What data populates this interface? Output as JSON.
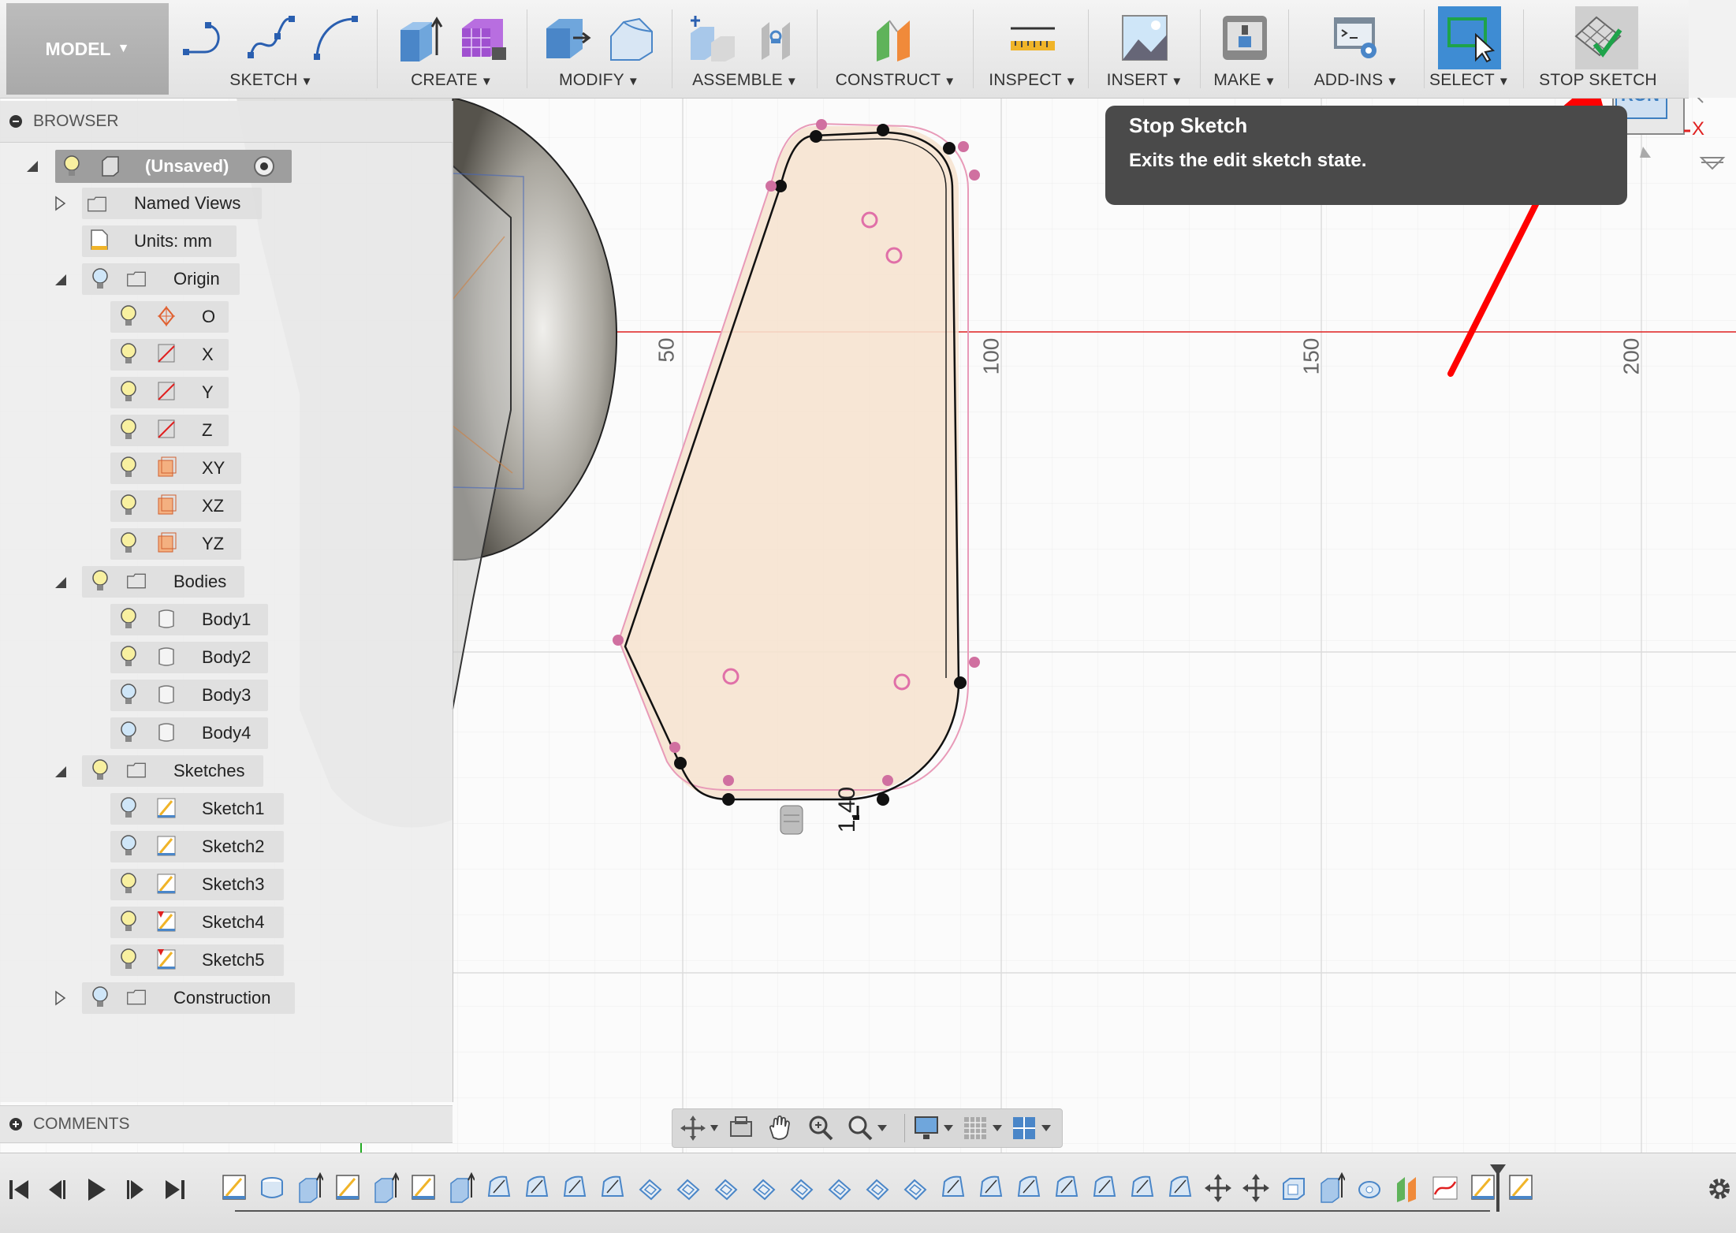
{
  "toolbar": {
    "workspace": "MODEL",
    "groups": [
      {
        "label": "SKETCH",
        "icons": [
          "line-icon",
          "spline-icon",
          "arc-icon"
        ]
      },
      {
        "label": "CREATE",
        "icons": [
          "extrude-icon",
          "pattern-icon"
        ]
      },
      {
        "label": "MODIFY",
        "icons": [
          "press-pull-icon",
          "fillet-icon"
        ]
      },
      {
        "label": "ASSEMBLE",
        "icons": [
          "new-component-icon",
          "joint-icon"
        ]
      },
      {
        "label": "CONSTRUCT",
        "icons": [
          "plane-icon"
        ]
      },
      {
        "label": "INSPECT",
        "icons": [
          "measure-icon"
        ]
      },
      {
        "label": "INSERT",
        "icons": [
          "insert-image-icon"
        ]
      },
      {
        "label": "MAKE",
        "icons": [
          "3d-print-icon"
        ]
      },
      {
        "label": "ADD-INS",
        "icons": [
          "scripts-icon"
        ]
      },
      {
        "label": "SELECT",
        "icons": [
          "select-icon"
        ]
      },
      {
        "label": "STOP SKETCH",
        "icons": [
          "stop-sketch-icon"
        ]
      }
    ]
  },
  "browser": {
    "title": "BROWSER",
    "root": "(Unsaved)",
    "items": {
      "named_views": "Named Views",
      "units": "Units: mm",
      "origin": "Origin",
      "origin_o": "O",
      "origin_x": "X",
      "origin_y": "Y",
      "origin_z": "Z",
      "origin_xy": "XY",
      "origin_xz": "XZ",
      "origin_yz": "YZ",
      "bodies": "Bodies",
      "body1": "Body1",
      "body2": "Body2",
      "body3": "Body3",
      "body4": "Body4",
      "sketches": "Sketches",
      "sketch1": "Sketch1",
      "sketch2": "Sketch2",
      "sketch3": "Sketch3",
      "sketch4": "Sketch4",
      "sketch5": "Sketch5",
      "construction": "Construction"
    }
  },
  "comments": {
    "title": "COMMENTS"
  },
  "tooltip": {
    "title": "Stop Sketch",
    "description": "Exits the edit sketch state."
  },
  "viewport": {
    "ruler_labels": [
      "50",
      "100",
      "150",
      "200"
    ],
    "dimension_label": "1.40",
    "viewcube_axis": "X",
    "viewcube_face": "RON"
  },
  "colors": {
    "select_accent": "#3e8cd3",
    "profile_fill": "#f6e3d0",
    "axis_red": "#e02020",
    "arrow_red": "#ff0000",
    "tooltip_bg": "#4a4a4a"
  }
}
